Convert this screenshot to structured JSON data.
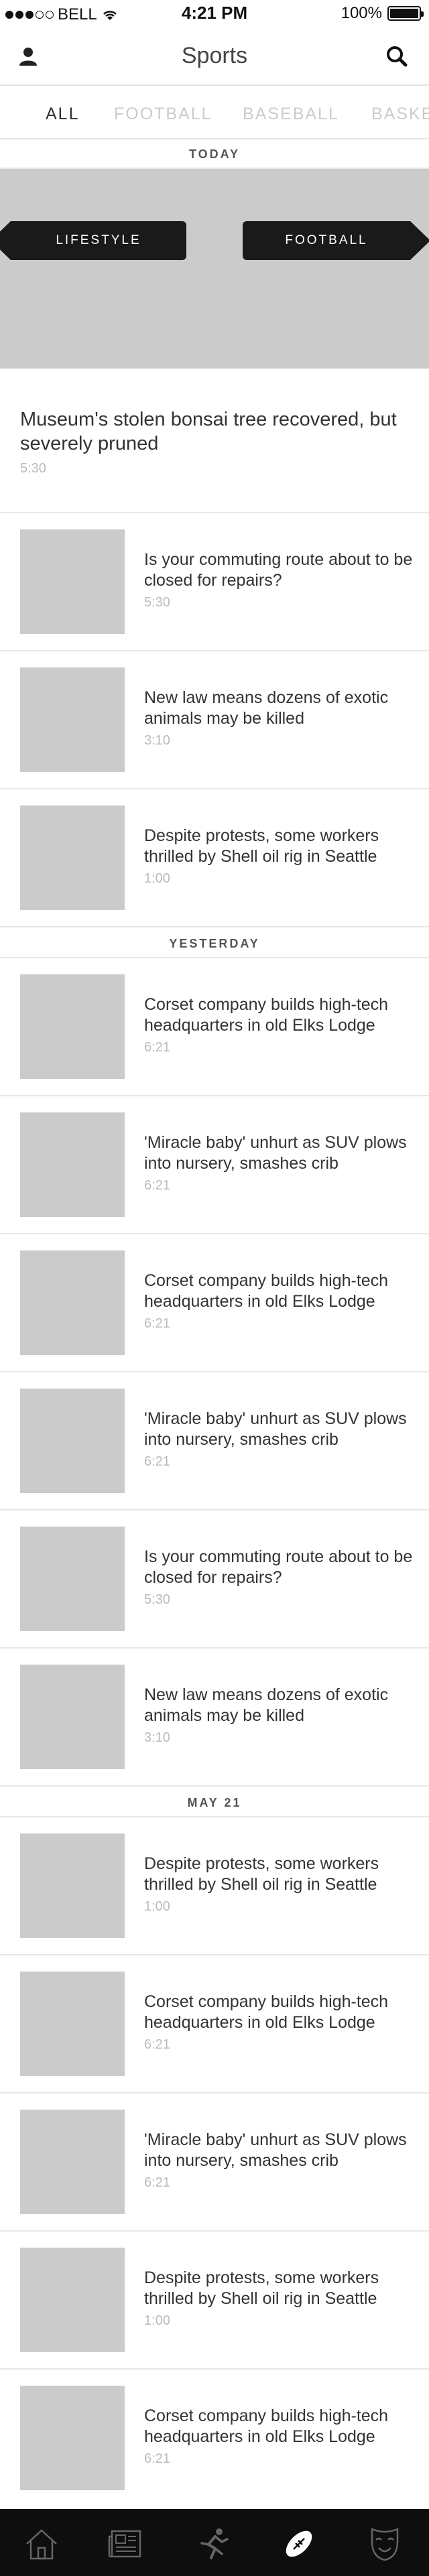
{
  "status_bar": {
    "carrier": "BELL",
    "time": "4:21 PM",
    "battery": "100%",
    "icons": [
      "signal-dots-icon",
      "wifi-icon",
      "battery-icon"
    ]
  },
  "header": {
    "title": "Sports",
    "left_icon": "profile-icon",
    "right_icon": "search-icon"
  },
  "tabs": [
    {
      "label": "ALL",
      "active": true
    },
    {
      "label": "FOOTBALL",
      "active": false
    },
    {
      "label": "BASEBALL",
      "active": false
    },
    {
      "label": "BASKE",
      "active": false
    }
  ],
  "sections": [
    {
      "label": "TODAY"
    },
    {
      "label": "YESTERDAY"
    },
    {
      "label": "MAY 21"
    }
  ],
  "hero": {
    "left_tag": "LIFESTYLE",
    "right_tag": "FOOTBALL"
  },
  "feature": {
    "title": "Museum's stolen bonsai tree recovered, but severely pruned",
    "time": "5:30"
  },
  "stories": [
    {
      "title": "Is your commuting route about to be closed for repairs?",
      "time": "5:30"
    },
    {
      "title": "New law means dozens of exotic animals may be killed",
      "time": "3:10"
    },
    {
      "title": "Despite protests, some workers thrilled by Shell oil rig in Seattle",
      "time": "1:00"
    },
    {
      "title": "Corset company builds high-tech headquarters in old Elks Lodge",
      "time": "6:21"
    },
    {
      "title": "'Miracle baby' unhurt as SUV plows into nursery, smashes crib",
      "time": "6:21"
    },
    {
      "title": "Corset company builds high-tech headquarters in old Elks Lodge",
      "time": "6:21"
    },
    {
      "title": "'Miracle baby' unhurt as SUV plows into nursery, smashes crib",
      "time": "6:21"
    },
    {
      "title": "Is your commuting route about to be closed for repairs?",
      "time": "5:30"
    },
    {
      "title": "New law means dozens of exotic animals may be killed",
      "time": "3:10"
    },
    {
      "title": "Despite protests, some workers thrilled by Shell oil rig in Seattle",
      "time": "1:00"
    },
    {
      "title": "Corset company builds high-tech headquarters in old Elks Lodge",
      "time": "6:21"
    },
    {
      "title": "'Miracle baby' unhurt as SUV plows into nursery, smashes crib",
      "time": "6:21"
    },
    {
      "title": "Despite protests, some workers thrilled by Shell oil rig in Seattle",
      "time": "1:00"
    },
    {
      "title": "Corset company builds high-tech headquarters in old Elks Lodge",
      "time": "6:21"
    }
  ],
  "bottom_nav": [
    {
      "icon": "home-icon",
      "active": false
    },
    {
      "icon": "newspaper-icon",
      "active": false
    },
    {
      "icon": "runner-icon",
      "active": false
    },
    {
      "icon": "football-icon",
      "active": true
    },
    {
      "icon": "theater-masks-icon",
      "active": false
    }
  ],
  "colors": {
    "placeholder": "#cbcbcb",
    "tag_bg": "#1a1a1a",
    "bottom_bar": "#0e0e0e",
    "inactive_tab": "#cccccc",
    "timestamp": "#bbbbbb"
  }
}
